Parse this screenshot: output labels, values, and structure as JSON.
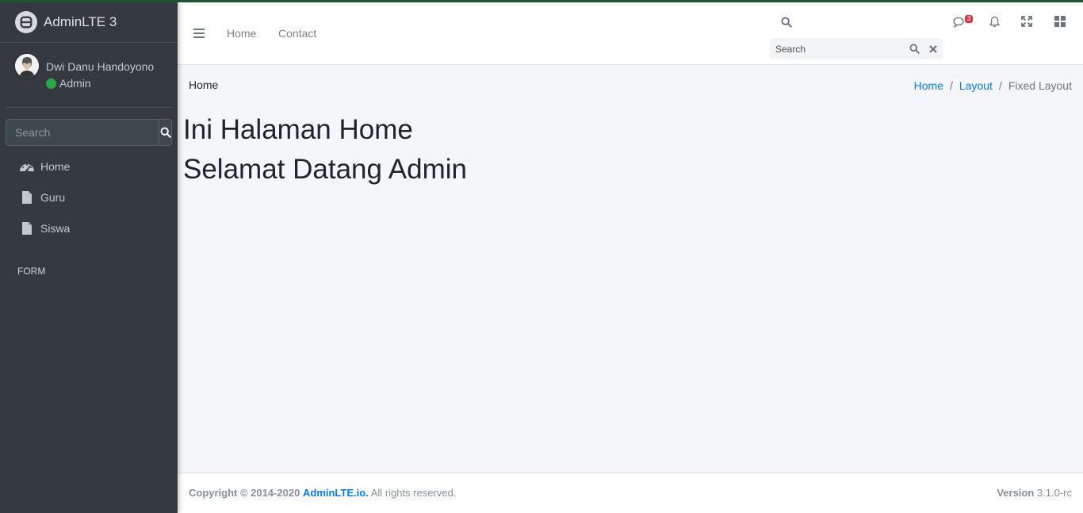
{
  "brand": {
    "name": "AdminLTE 3"
  },
  "user": {
    "name": "Dwi Danu Handoyono",
    "role": "Admin"
  },
  "sidebar": {
    "search_placeholder": "Search",
    "items": [
      {
        "label": "Home",
        "icon": "dashboard-icon"
      },
      {
        "label": "Guru",
        "icon": "file-icon"
      },
      {
        "label": "Siswa",
        "icon": "file-icon"
      }
    ],
    "header": "FORM"
  },
  "navbar": {
    "links": [
      "Home",
      "Contact"
    ],
    "search_placeholder": "Search",
    "messages_badge": "3",
    "icons": [
      "menu-icon",
      "search-icon",
      "comments-icon",
      "bell-icon",
      "expand-icon",
      "grid-icon"
    ]
  },
  "content": {
    "page_title": "Home",
    "breadcrumb": [
      "Home",
      "Layout",
      "Fixed Layout"
    ],
    "heading1": "Ini Halaman Home",
    "heading2": "Selamat Datang Admin"
  },
  "footer": {
    "copyright": "Copyright © 2014-2020",
    "link": "AdminLTE.io.",
    "rights": "All rights reserved.",
    "version_label": "Version",
    "version": "3.1.0-rc"
  },
  "colors": {
    "sidebar": "#343a40",
    "accent": "#007bff",
    "status": "#28a745",
    "badge": "#dc3545"
  }
}
